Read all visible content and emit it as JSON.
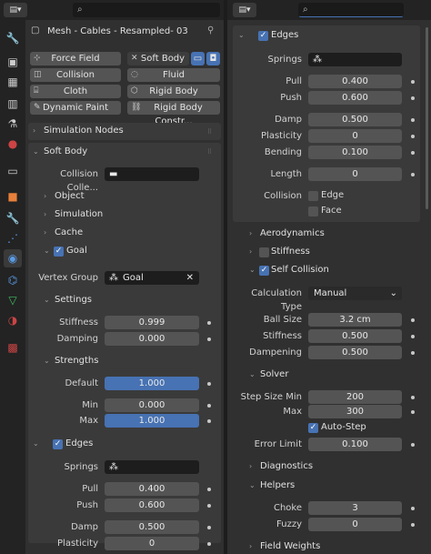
{
  "left": {
    "editor_icon": "editor-type-icon",
    "search_placeholder": "",
    "tabs": [
      "tool-icon",
      "render-icon",
      "output-icon",
      "view-layer-icon",
      "scene-icon",
      "world-icon",
      "collection-icon",
      "object-icon",
      "modifier-icon",
      "particles-icon",
      "physics-icon",
      "constraints-icon",
      "data-icon",
      "material-icon",
      "texture-icon"
    ],
    "object_name": "Mesh - Cables - Resampled- 03",
    "physics_buttons": [
      {
        "label": "Force Field",
        "icon": "force-field-icon"
      },
      {
        "label": "Soft Body",
        "icon": "close-icon"
      },
      {
        "label": "Collision",
        "icon": "collision-icon"
      },
      {
        "label": "Fluid",
        "icon": "fluid-icon"
      },
      {
        "label": "Cloth",
        "icon": "cloth-icon"
      },
      {
        "label": "Rigid Body",
        "icon": "rigid-body-icon"
      },
      {
        "label": "Dynamic Paint",
        "icon": "dynamic-paint-icon"
      },
      {
        "label": "Rigid Body Constr...",
        "icon": "rigid-body-constraint-icon"
      }
    ],
    "simulation_nodes": "Simulation Nodes",
    "soft_body": "Soft Body",
    "collision_collection_label": "Collision Colle...",
    "object": "Object",
    "simulation": "Simulation",
    "cache": "Cache",
    "goal": "Goal",
    "vertex_group_label": "Vertex Group",
    "vertex_group_value": "Goal",
    "settings": "Settings",
    "stiffness_label": "Stiffness",
    "stiffness_value": "0.999",
    "damping_label": "Damping",
    "damping_value": "0.000",
    "strengths": "Strengths",
    "default_label": "Default",
    "default_value": "1.000",
    "min_label": "Min",
    "min_value": "0.000",
    "max_label": "Max",
    "max_value": "1.000",
    "edges": "Edges",
    "springs_label": "Springs",
    "pull_label": "Pull",
    "pull_value": "0.400",
    "push_label": "Push",
    "push_value": "0.600",
    "damp_label": "Damp",
    "damp_value": "0.500",
    "plasticity_label": "Plasticity",
    "plasticity_value": "0"
  },
  "right": {
    "edges": "Edges",
    "springs_label": "Springs",
    "pull_label": "Pull",
    "pull_value": "0.400",
    "push_label": "Push",
    "push_value": "0.600",
    "damp_label": "Damp",
    "damp_value": "0.500",
    "plasticity_label": "Plasticity",
    "plasticity_value": "0",
    "bending_label": "Bending",
    "bending_value": "0.100",
    "length_label": "Length",
    "length_value": "0",
    "collision_label": "Collision",
    "edge_label": "Edge",
    "face_label": "Face",
    "aerodynamics": "Aerodynamics",
    "stiffness": "Stiffness",
    "self_collision": "Self Collision",
    "calc_type_label": "Calculation Type",
    "calc_type_value": "Manual",
    "ball_size_label": "Ball Size",
    "ball_size_value": "3.2 cm",
    "sc_stiffness_label": "Stiffness",
    "sc_stiffness_value": "0.500",
    "dampening_label": "Dampening",
    "dampening_value": "0.500",
    "solver": "Solver",
    "step_min_label": "Step Size Min",
    "step_min_value": "200",
    "step_max_label": "Max",
    "step_max_value": "300",
    "auto_step": "Auto-Step",
    "error_limit_label": "Error Limit",
    "error_limit_value": "0.100",
    "diagnostics": "Diagnostics",
    "helpers": "Helpers",
    "choke_label": "Choke",
    "choke_value": "3",
    "fuzzy_label": "Fuzzy",
    "fuzzy_value": "0",
    "field_weights": "Field Weights"
  },
  "colors": {
    "accent": "#4772b3",
    "panel": "#303030",
    "field": "#545454"
  }
}
